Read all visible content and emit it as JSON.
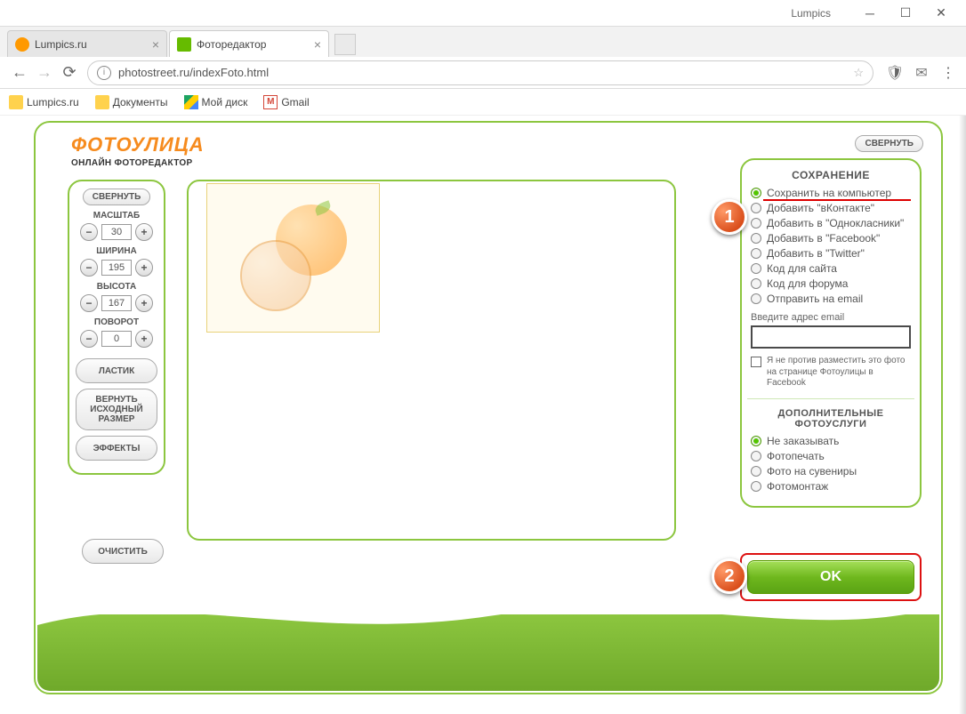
{
  "window": {
    "app": "Lumpics"
  },
  "tabs": [
    {
      "title": "Lumpics.ru"
    },
    {
      "title": "Фоторедактор"
    }
  ],
  "address": {
    "url": "photostreet.ru/indexFoto.html"
  },
  "bookmarks": {
    "b1": "Lumpics.ru",
    "b2": "Документы",
    "b3": "Мой диск",
    "b4": "Gmail"
  },
  "logo": {
    "line1": "ФОТОУЛИЦА",
    "line2": "ОНЛАЙН ФОТОРЕДАКТОР"
  },
  "buttons": {
    "collapse": "СВЕРНУТЬ",
    "eraser": "ЛАСТИК",
    "reset": "ВЕРНУТЬ ИСХОДНЫЙ РАЗМЕР",
    "effects": "ЭФФЕКТЫ",
    "clear": "ОЧИСТИТЬ",
    "ok": "OK"
  },
  "controls": {
    "scale": {
      "label": "МАСШТАБ",
      "value": "30"
    },
    "width": {
      "label": "ШИРИНА",
      "value": "195"
    },
    "height": {
      "label": "ВЫСОТА",
      "value": "167"
    },
    "rotate": {
      "label": "ПОВОРОТ",
      "value": "0"
    }
  },
  "save": {
    "title": "СОХРАНЕНИЕ",
    "opts": [
      "Сохранить на компьютер",
      "Добавить \"вКонтакте\"",
      "Добавить в \"Однокласники\"",
      "Добавить в \"Facebook\"",
      "Добавить в \"Twitter\"",
      "Код для сайта",
      "Код для форума",
      "Отправить на email"
    ],
    "emailLabel": "Введите адрес email",
    "disclaimer": "Я не против разместить это фото на странице Фотоулицы в Facebook"
  },
  "services": {
    "title": "ДОПОЛНИТЕЛЬНЫЕ ФОТОУСЛУГИ",
    "opts": [
      "Не заказывать",
      "Фотопечать",
      "Фото на сувениры",
      "Фотомонтаж"
    ]
  },
  "markers": {
    "m1": "1",
    "m2": "2"
  }
}
